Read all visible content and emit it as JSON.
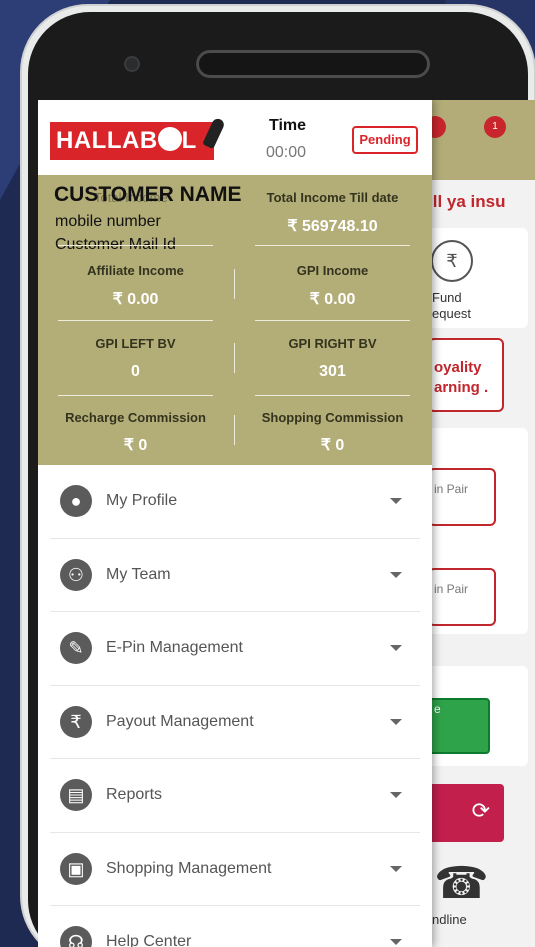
{
  "header": {
    "brand_left": "HALLAB",
    "brand_right": "L",
    "time_label": "Time",
    "time_value": "00:00",
    "status": "Pending"
  },
  "customer": {
    "name": "CUSTOMER NAME",
    "mobile": "mobile number",
    "email": "Customer Mail Id"
  },
  "stats": [
    {
      "label": "Total Income Till date",
      "value": "₹ 569748.10"
    },
    {
      "label": "Affiliate Income",
      "value": "₹ 0.00"
    },
    {
      "label": "GPI Income",
      "value": "₹ 0.00"
    },
    {
      "label": "GPI LEFT BV",
      "value": "0"
    },
    {
      "label": "GPI RIGHT BV",
      "value": "301"
    },
    {
      "label": "Recharge Commission",
      "value": "₹ 0"
    },
    {
      "label": "Shopping Commission",
      "value": "₹ 0"
    }
  ],
  "menu": [
    {
      "label": "My Profile",
      "icon": "person-icon"
    },
    {
      "label": "My Team",
      "icon": "team-icon"
    },
    {
      "label": "E-Pin Management",
      "icon": "epin-icon"
    },
    {
      "label": "Payout Management",
      "icon": "rupee-icon"
    },
    {
      "label": "Reports",
      "icon": "reports-icon"
    },
    {
      "label": "Shopping Management",
      "icon": "shopping-bag-icon"
    },
    {
      "label": "Help Center",
      "icon": "headset-icon"
    }
  ],
  "background_app": {
    "marquee": "ill ya insu",
    "fund_label_1": "Fund",
    "fund_label_2": "equest",
    "royalty_1": "oyality",
    "royalty_2": "arning .",
    "pair_1": "in Pair",
    "pair_2": "in Pair",
    "green_label": "e",
    "landline": "ndline",
    "notification_count": "1"
  },
  "colors": {
    "brand_red": "#d9252a",
    "stats_bg": "#b3ad78",
    "page_bg": "#1e2a52"
  }
}
